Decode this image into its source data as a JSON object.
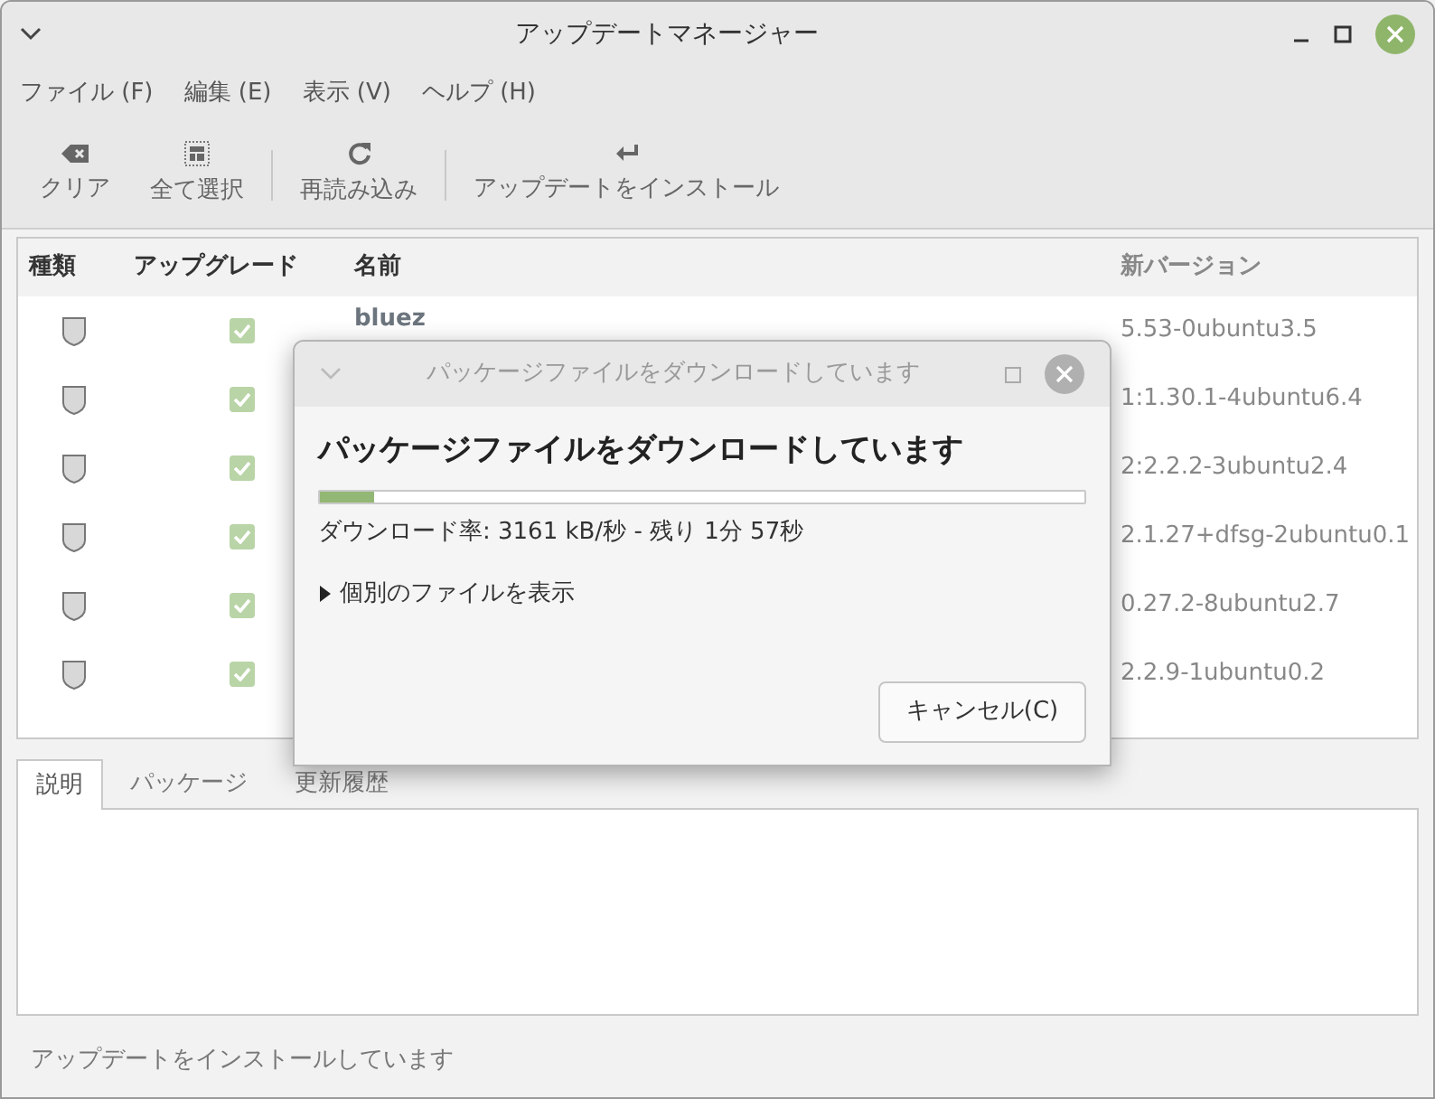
{
  "window": {
    "title": "アップデートマネージャー"
  },
  "menu": [
    "ファイル (F)",
    "編集 (E)",
    "表示 (V)",
    "ヘルプ (H)"
  ],
  "toolbar": {
    "groups": [
      [
        {
          "label": "クリア",
          "kind": "clear"
        },
        {
          "label": "全て選択",
          "kind": "select-all"
        }
      ],
      [
        {
          "label": "再読み込み",
          "kind": "refresh"
        }
      ],
      [
        {
          "label": "アップデートをインストール",
          "kind": "install"
        }
      ]
    ]
  },
  "table": {
    "columns": [
      "種類",
      "アップグレード",
      "名前",
      "新バージョン"
    ],
    "rows": [
      {
        "checked": true,
        "name": "bluez",
        "version": "5.53-0ubuntu3.5"
      },
      {
        "checked": true,
        "version": "1:1.30.1-4ubuntu6.4"
      },
      {
        "checked": true,
        "version": "2:2.2.2-3ubuntu2.4"
      },
      {
        "checked": true,
        "version": "2.1.27+dfsg-2ubuntu0.1"
      },
      {
        "checked": true,
        "version": "0.27.2-8ubuntu2.7"
      },
      {
        "checked": true,
        "version": "2.2.9-1ubuntu0.2"
      }
    ]
  },
  "tabs": [
    {
      "label": "説明",
      "selected": true
    },
    {
      "label": "パッケージ",
      "selected": false
    },
    {
      "label": "更新履歴",
      "selected": false
    }
  ],
  "status_bar": "アップデートをインストールしています",
  "dialog": {
    "title": "パッケージファイルをダウンロードしています",
    "heading": "パッケージファイルをダウンロードしています",
    "level": 0.07,
    "progress_text": "ダウンロード率: 3161 kB/秒 - 残り 1分 57秒",
    "expander": {
      "label": "個別のファイルを表示",
      "expanded": false
    },
    "buttons": [
      "キャンセル(C)"
    ]
  }
}
